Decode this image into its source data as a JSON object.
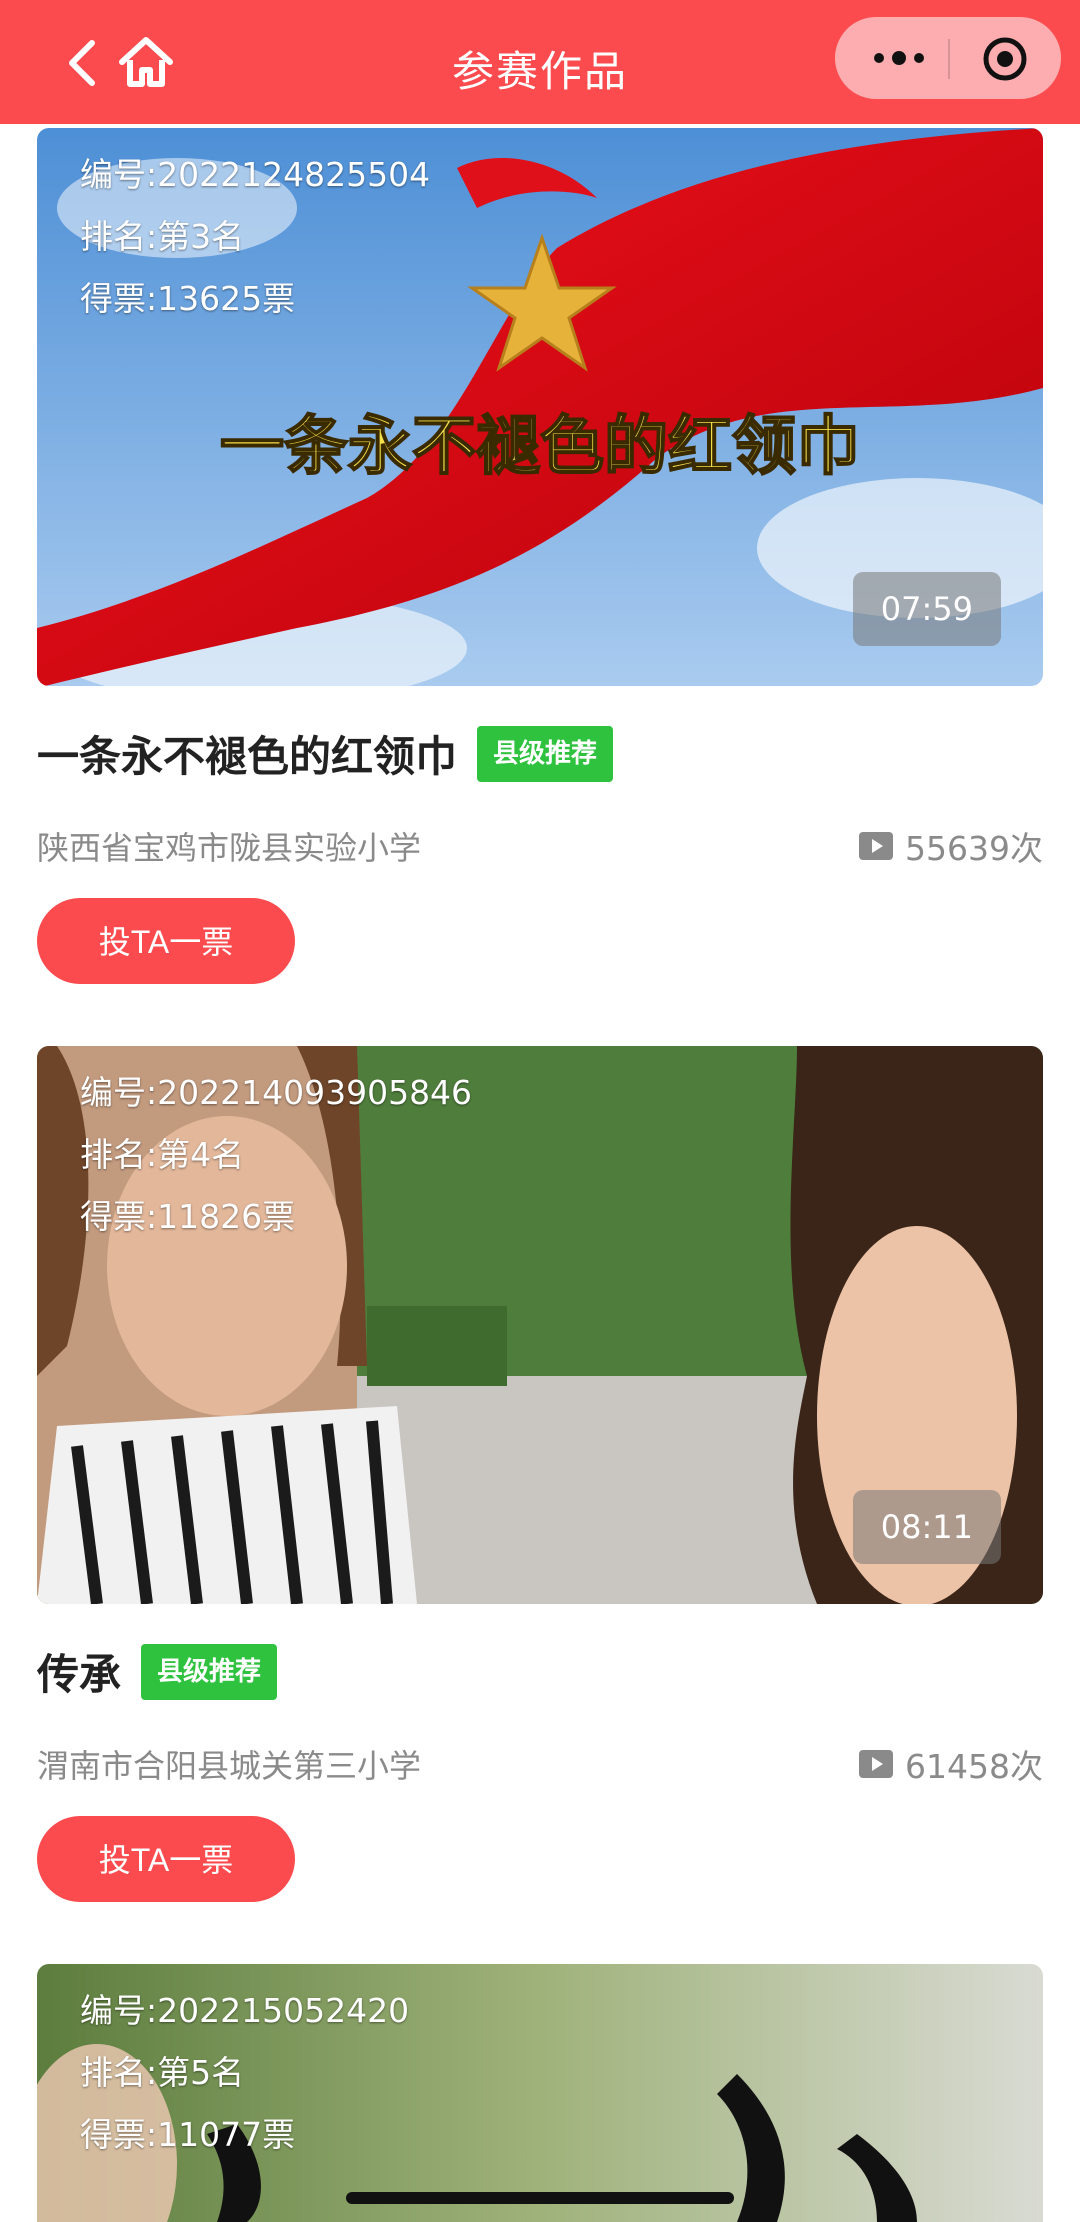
{
  "header": {
    "title": "参赛作品"
  },
  "entries": [
    {
      "id_text": "编号:2022124825504",
      "rank_text": "排名:第3名",
      "votes_text": "得票:13625票",
      "duration": "07:59",
      "title": "一条永不褪色的红领巾",
      "badge": "县级推荐",
      "school": "陕西省宝鸡市陇县实验小学",
      "views": "55639次",
      "vote_label": "投TA一票",
      "thumbnail_caption": "一条永不褪色的红领巾"
    },
    {
      "id_text": "编号:202214093905846",
      "rank_text": "排名:第4名",
      "votes_text": "得票:11826票",
      "duration": "08:11",
      "title": "传承",
      "badge": "县级推荐",
      "school": "渭南市合阳县城关第三小学",
      "views": "61458次",
      "vote_label": "投TA一票"
    },
    {
      "id_text": "编号:202215052420",
      "rank_text": "排名:第5名",
      "votes_text": "得票:11077票"
    }
  ],
  "colors": {
    "brand_red": "#fb4b4e",
    "badge_green": "#2fc23f"
  }
}
